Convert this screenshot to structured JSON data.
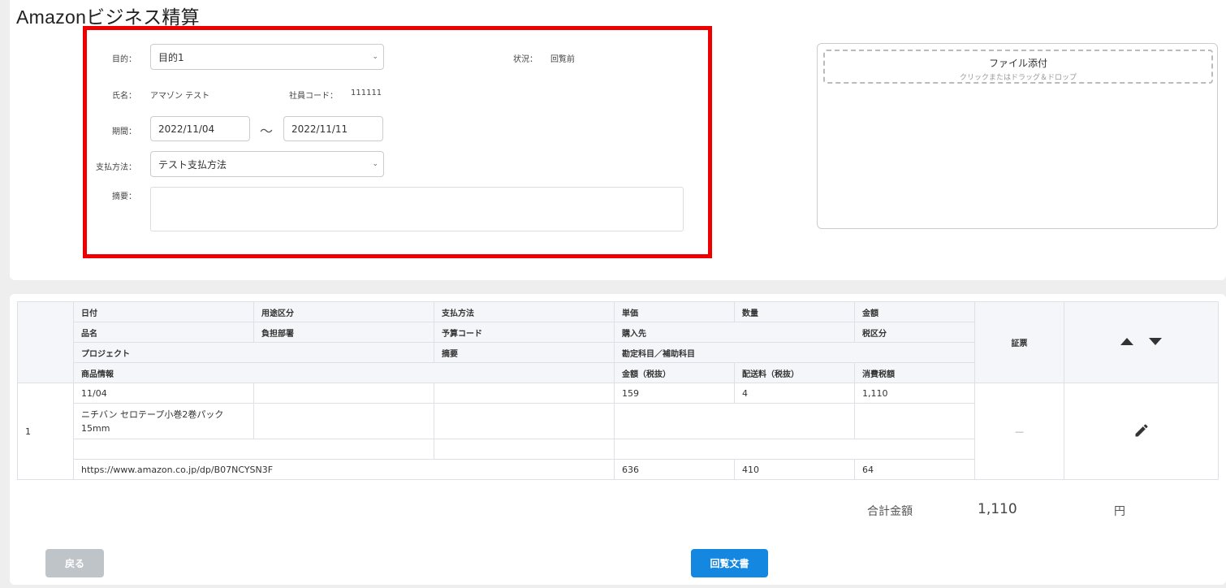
{
  "page": {
    "title": "Amazonビジネス精算"
  },
  "form": {
    "purpose_label": "目的：",
    "purpose_value": "目的1",
    "status_label": "状況：",
    "status_value": "回覧前",
    "name_label": "氏名：",
    "name_value": "アマゾン テスト",
    "employee_code_label": "社員コード：",
    "employee_code_value": "111111",
    "period_label": "期間：",
    "period_start": "2022/11/04",
    "period_separator": "～",
    "period_end": "2022/11/11",
    "payment_label": "支払方法：",
    "payment_value": "テスト支払方法",
    "summary_label": "摘要：",
    "summary_value": ""
  },
  "attachment": {
    "title": "ファイル添付",
    "hint": "クリックまたはドラッグ＆ドロップ"
  },
  "table": {
    "headers": {
      "row1": [
        "日付",
        "用途区分",
        "支払方法",
        "単価",
        "数量",
        "金額"
      ],
      "row2": [
        "品名",
        "負担部署",
        "予算コード",
        "購入先",
        "税区分"
      ],
      "row3": [
        "プロジェクト",
        "摘要",
        "勘定科目／補助科目"
      ],
      "row4": [
        "商品情報",
        "金額（税抜）",
        "配送料（税抜）",
        "消費税額"
      ],
      "voucher": "証票"
    },
    "rows": [
      {
        "index": "1",
        "date": "11/04",
        "usage": "",
        "payment": "",
        "unit_price": "159",
        "quantity": "4",
        "amount": "1,110",
        "item_name_line1": "ニチバン セロテープ小巻2巻パック",
        "item_name_line2": "15mm",
        "department": "",
        "budget_code": "",
        "supplier": "",
        "tax_category": "",
        "project": "",
        "summary": "",
        "account": "",
        "product_info": "https://www.amazon.co.jp/dp/B07NCYSN3F",
        "amount_excl_tax": "636",
        "shipping_excl_tax": "410",
        "consumption_tax": "64",
        "voucher": "—"
      }
    ]
  },
  "total": {
    "label": "合計金額",
    "value": "1,110",
    "unit": "円"
  },
  "buttons": {
    "back": "戻る",
    "circulate": "回覧文書"
  },
  "icons": {
    "edit": "pencil-icon",
    "up": "triangle-up-icon",
    "down": "triangle-down-icon",
    "caret": "chevron-down-icon"
  }
}
